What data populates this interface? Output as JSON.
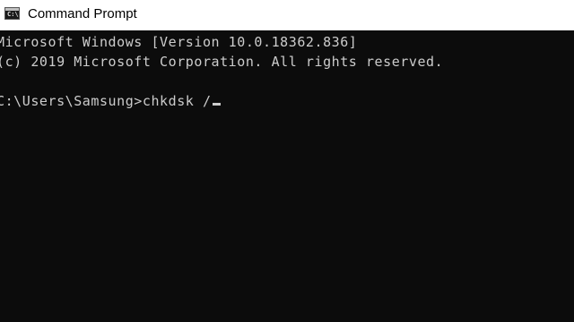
{
  "window": {
    "title": "Command Prompt",
    "icon": "cmd-icon",
    "icon_glyph": "C:\\"
  },
  "console": {
    "lines": [
      "Microsoft Windows [Version 10.0.18362.836]",
      "(c) 2019 Microsoft Corporation. All rights reserved."
    ],
    "prompt": "C:\\Users\\Samsung>",
    "command": "chkdsk /"
  },
  "colors": {
    "console_background": "#0c0c0c",
    "console_text": "#cccccc",
    "titlebar_background": "#ffffff"
  }
}
